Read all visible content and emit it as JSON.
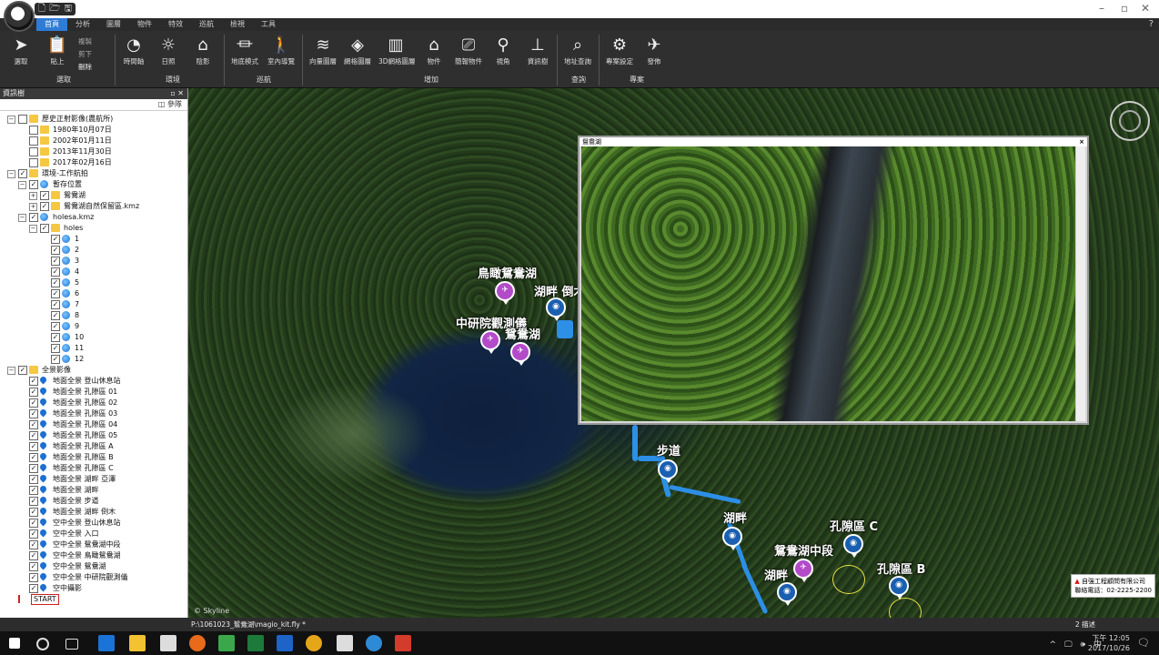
{
  "titlebar": {
    "window_controls": [
      "–",
      "▫",
      "✕"
    ]
  },
  "ribbon": {
    "tabs": [
      "首頁",
      "分析",
      "圖層",
      "物件",
      "特效",
      "巡航",
      "檢視",
      "工具"
    ],
    "active_tab": "首頁",
    "help": "?",
    "buttons": [
      {
        "label": "選取",
        "icon": "cursor-icon"
      },
      {
        "label": "貼上",
        "icon": "paste-icon"
      },
      {
        "label": "時間軸",
        "icon": "clock-icon"
      },
      {
        "label": "日照",
        "icon": "sun-icon"
      },
      {
        "label": "陰影",
        "icon": "shadow-icon"
      },
      {
        "label": "地底模式",
        "icon": "underground-icon"
      },
      {
        "label": "室內導覽",
        "icon": "walk-icon"
      },
      {
        "label": "向量圖層",
        "icon": "layers-icon"
      },
      {
        "label": "網格圖層",
        "icon": "grid-layers-icon"
      },
      {
        "label": "3D網格圖層",
        "icon": "building-icon"
      },
      {
        "label": "物件",
        "icon": "house-icon"
      },
      {
        "label": "簡報物件",
        "icon": "presentation-icon"
      },
      {
        "label": "視角",
        "icon": "location-icon"
      },
      {
        "label": "資訊樹",
        "icon": "tree-icon"
      },
      {
        "label": "地址查詢",
        "icon": "search-icon"
      },
      {
        "label": "專案設定",
        "icon": "gear-icon"
      },
      {
        "label": "發佈",
        "icon": "publish-icon"
      }
    ],
    "small_buttons": [
      "複製",
      "剪下",
      "刪除"
    ],
    "groups": [
      "選取",
      "環境",
      "巡航",
      "增加",
      "查詢",
      "專案"
    ]
  },
  "panel": {
    "title": "資訊樹",
    "pin": "▫ ✕",
    "toolbar": "◫ 參隊",
    "tree": [
      {
        "level": 0,
        "exp": "−",
        "icon": "folder",
        "label": "歷史正射影像(農航所)"
      },
      {
        "level": 1,
        "exp": "",
        "icon": "folder",
        "label": "1980年10月07日"
      },
      {
        "level": 1,
        "exp": "",
        "icon": "folder",
        "label": "2002年01月11日"
      },
      {
        "level": 1,
        "exp": "",
        "icon": "folder",
        "label": "2013年11月30日"
      },
      {
        "level": 1,
        "exp": "",
        "icon": "folder",
        "label": "2017年02月16日"
      },
      {
        "level": 0,
        "exp": "−",
        "icon": "folder",
        "label": "環境-工作航拍",
        "check": "✓"
      },
      {
        "level": 1,
        "exp": "−",
        "icon": "globe",
        "label": "暫存位置",
        "check": "✓"
      },
      {
        "level": 2,
        "exp": "+",
        "icon": "folder",
        "label": "鴛鴦湖",
        "check": "✓"
      },
      {
        "level": 2,
        "exp": "+",
        "icon": "folder",
        "label": "鴛鴦湖自然保留區.kmz",
        "check": "✓"
      },
      {
        "level": 1,
        "exp": "−",
        "icon": "globe",
        "label": "holesa.kmz",
        "check": "✓"
      },
      {
        "level": 2,
        "exp": "−",
        "icon": "folder",
        "label": "holes",
        "check": "✓"
      },
      {
        "level": 3,
        "exp": "",
        "icon": "globe",
        "label": "1",
        "check": "✓"
      },
      {
        "level": 3,
        "exp": "",
        "icon": "globe",
        "label": "2",
        "check": "✓"
      },
      {
        "level": 3,
        "exp": "",
        "icon": "globe",
        "label": "3",
        "check": "✓"
      },
      {
        "level": 3,
        "exp": "",
        "icon": "globe",
        "label": "4",
        "check": "✓"
      },
      {
        "level": 3,
        "exp": "",
        "icon": "globe",
        "label": "5",
        "check": "✓"
      },
      {
        "level": 3,
        "exp": "",
        "icon": "globe",
        "label": "6",
        "check": "✓"
      },
      {
        "level": 3,
        "exp": "",
        "icon": "globe",
        "label": "7",
        "check": "✓"
      },
      {
        "level": 3,
        "exp": "",
        "icon": "globe",
        "label": "8",
        "check": "✓"
      },
      {
        "level": 3,
        "exp": "",
        "icon": "globe",
        "label": "9",
        "check": "✓"
      },
      {
        "level": 3,
        "exp": "",
        "icon": "globe",
        "label": "10",
        "check": "✓"
      },
      {
        "level": 3,
        "exp": "",
        "icon": "globe",
        "label": "11",
        "check": "✓"
      },
      {
        "level": 3,
        "exp": "",
        "icon": "globe",
        "label": "12",
        "check": "✓"
      },
      {
        "level": 0,
        "exp": "−",
        "icon": "folder",
        "label": "全景影像",
        "check": "✓"
      },
      {
        "level": 1,
        "exp": "",
        "icon": "pin",
        "label": "地面全景 登山休息站",
        "check": "✓"
      },
      {
        "level": 1,
        "exp": "",
        "icon": "pin",
        "label": "地面全景 孔隙區 01",
        "check": "✓"
      },
      {
        "level": 1,
        "exp": "",
        "icon": "pin",
        "label": "地面全景 孔隙區 02",
        "check": "✓"
      },
      {
        "level": 1,
        "exp": "",
        "icon": "pin",
        "label": "地面全景 孔隙區 03",
        "check": "✓"
      },
      {
        "level": 1,
        "exp": "",
        "icon": "pin",
        "label": "地面全景 孔隙區 04",
        "check": "✓"
      },
      {
        "level": 1,
        "exp": "",
        "icon": "pin",
        "label": "地面全景 孔隙區 05",
        "check": "✓"
      },
      {
        "level": 1,
        "exp": "",
        "icon": "pin",
        "label": "地面全景 孔隙區 A",
        "check": "✓"
      },
      {
        "level": 1,
        "exp": "",
        "icon": "pin",
        "label": "地面全景 孔隙區 B",
        "check": "✓"
      },
      {
        "level": 1,
        "exp": "",
        "icon": "pin",
        "label": "地面全景 孔隙區 C",
        "check": "✓"
      },
      {
        "level": 1,
        "exp": "",
        "icon": "pin",
        "label": "地面全景 湖畔 亞澤",
        "check": "✓"
      },
      {
        "level": 1,
        "exp": "",
        "icon": "pin",
        "label": "地面全景 湖畔",
        "check": "✓"
      },
      {
        "level": 1,
        "exp": "",
        "icon": "pin",
        "label": "地面全景 步道",
        "check": "✓"
      },
      {
        "level": 1,
        "exp": "",
        "icon": "pin",
        "label": "地面全景 湖畔 倒木",
        "check": "✓"
      },
      {
        "level": 1,
        "exp": "",
        "icon": "pin",
        "label": "空中全景 登山休息站",
        "check": "✓"
      },
      {
        "level": 1,
        "exp": "",
        "icon": "pin",
        "label": "空中全景 入口",
        "check": "✓"
      },
      {
        "level": 1,
        "exp": "",
        "icon": "pin",
        "label": "空中全景 鴛鴦湖中段",
        "check": "✓"
      },
      {
        "level": 1,
        "exp": "",
        "icon": "pin",
        "label": "空中全景 鳥瞰鴛鴦湖",
        "check": "✓"
      },
      {
        "level": 1,
        "exp": "",
        "icon": "pin",
        "label": "空中全景 鴛鴦湖",
        "check": "✓"
      },
      {
        "level": 1,
        "exp": "",
        "icon": "pin",
        "label": "空中全景 中研院觀測儀",
        "check": "✓"
      },
      {
        "level": 1,
        "exp": "",
        "icon": "pin",
        "label": "空中攝影",
        "check": "✓"
      },
      {
        "level": 0,
        "exp": "",
        "icon": "flag",
        "label": "START"
      }
    ]
  },
  "map": {
    "labels": [
      {
        "text": "鳥瞰鴛鴦湖"
      },
      {
        "text": "湖畔 倒木"
      },
      {
        "text": "中研院觀測儀"
      },
      {
        "text": "鴛鴦湖"
      },
      {
        "text": "步道"
      },
      {
        "text": "湖畔"
      },
      {
        "text": "孔隙區 C"
      },
      {
        "text": "鴛鴦湖中段"
      },
      {
        "text": "湖畔"
      },
      {
        "text": "孔隙區 B"
      }
    ],
    "pano_badge": "720°",
    "skyline": "© Skyline",
    "logo_company": "自強工程顧問有限公司",
    "logo_phone": "聯絡電話：02-2225-2200",
    "popup_title": "鴛鴦湖",
    "popup_close": "×"
  },
  "status": {
    "file": "P:\\1061023_鴛鴦湖\\magio_kit.fly *",
    "right": "2 描述"
  },
  "taskbar": {
    "tray": "^ 🖵 🕪 中",
    "time": "下午 12:05",
    "date": "2017/10/26",
    "notify": "🗨"
  }
}
